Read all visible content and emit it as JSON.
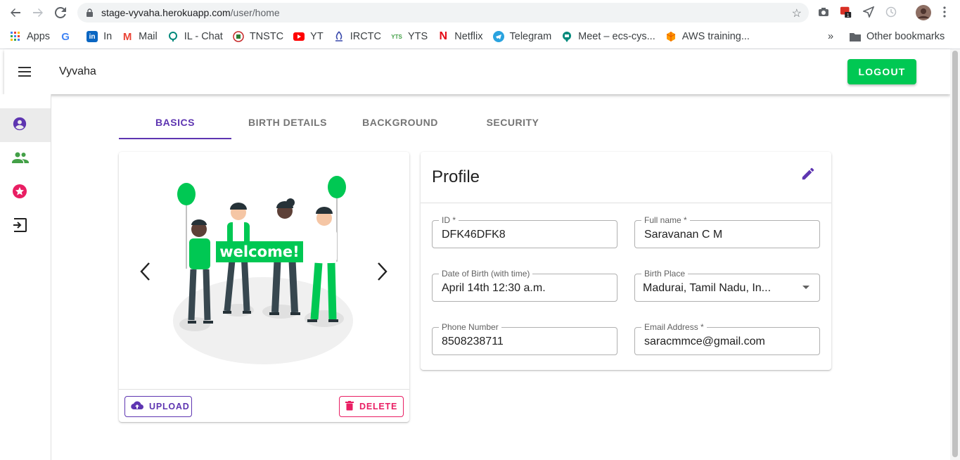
{
  "browser": {
    "url_host": "stage-vyvaha.herokuapp.com",
    "url_path": "/user/home",
    "bookmarks": [
      {
        "label": "Apps",
        "icon": "apps-grid-icon",
        "color": "#4285f4"
      },
      {
        "label": "",
        "icon": "google-icon",
        "color": "#4285f4"
      },
      {
        "label": "In",
        "icon": "linkedin-icon",
        "color": "#0a66c2"
      },
      {
        "label": "Mail",
        "icon": "gmail-icon",
        "color": "#ea4335"
      },
      {
        "label": "IL - Chat",
        "icon": "chat-icon",
        "color": "#00897b"
      },
      {
        "label": "TNSTC",
        "icon": "tnstc-icon",
        "color": "#c62828"
      },
      {
        "label": "YT",
        "icon": "youtube-icon",
        "color": "#ff0000"
      },
      {
        "label": "IRCTC",
        "icon": "irctc-icon",
        "color": "#3949ab"
      },
      {
        "label": "YTS",
        "icon": "yts-icon",
        "color": "#43a047"
      },
      {
        "label": "Netflix",
        "icon": "netflix-icon",
        "color": "#e50914"
      },
      {
        "label": "Telegram",
        "icon": "telegram-icon",
        "color": "#2aa3df"
      },
      {
        "label": "Meet – ecs-cys...",
        "icon": "meet-icon",
        "color": "#00897b"
      },
      {
        "label": "AWS training...",
        "icon": "aws-icon",
        "color": "#ff9900"
      }
    ],
    "overflow": "»",
    "other_bookmarks": "Other bookmarks"
  },
  "appbar": {
    "brand": "Vyvaha",
    "logout_label": "LOGOUT"
  },
  "sidenav": [
    {
      "icon": "account-circle-icon",
      "color": "#5e35b1",
      "active": true
    },
    {
      "icon": "people-icon",
      "color": "#43a047",
      "active": false
    },
    {
      "icon": "star-badge-icon",
      "color": "#e91e63",
      "active": false
    },
    {
      "icon": "logout-exit-icon",
      "color": "#212121",
      "active": false
    }
  ],
  "tabs": [
    {
      "label": "BASICS",
      "active": true
    },
    {
      "label": "BIRTH DETAILS",
      "active": false
    },
    {
      "label": "BACKGROUND",
      "active": false
    },
    {
      "label": "SECURITY",
      "active": false
    }
  ],
  "photo": {
    "banner_text": "welcome!",
    "upload_label": "UPLOAD",
    "delete_label": "DELETE"
  },
  "profile": {
    "title": "Profile",
    "fields": {
      "id": {
        "label": "ID *",
        "value": "DFK46DFK8"
      },
      "full_name": {
        "label": "Full name *",
        "value": "Saravanan C M"
      },
      "dob": {
        "label": "Date of Birth (with time)",
        "value": "April 14th 12:30 a.m."
      },
      "birth_place": {
        "label": "Birth Place",
        "value": "Madurai, Tamil Nadu, In..."
      },
      "phone": {
        "label": "Phone Number",
        "value": "8508238711"
      },
      "email": {
        "label": "Email Address *",
        "value": "saracmmce@gmail.com"
      }
    }
  },
  "colors": {
    "accent": "#5e35b1",
    "success": "#00c853",
    "danger": "#e91e63"
  }
}
